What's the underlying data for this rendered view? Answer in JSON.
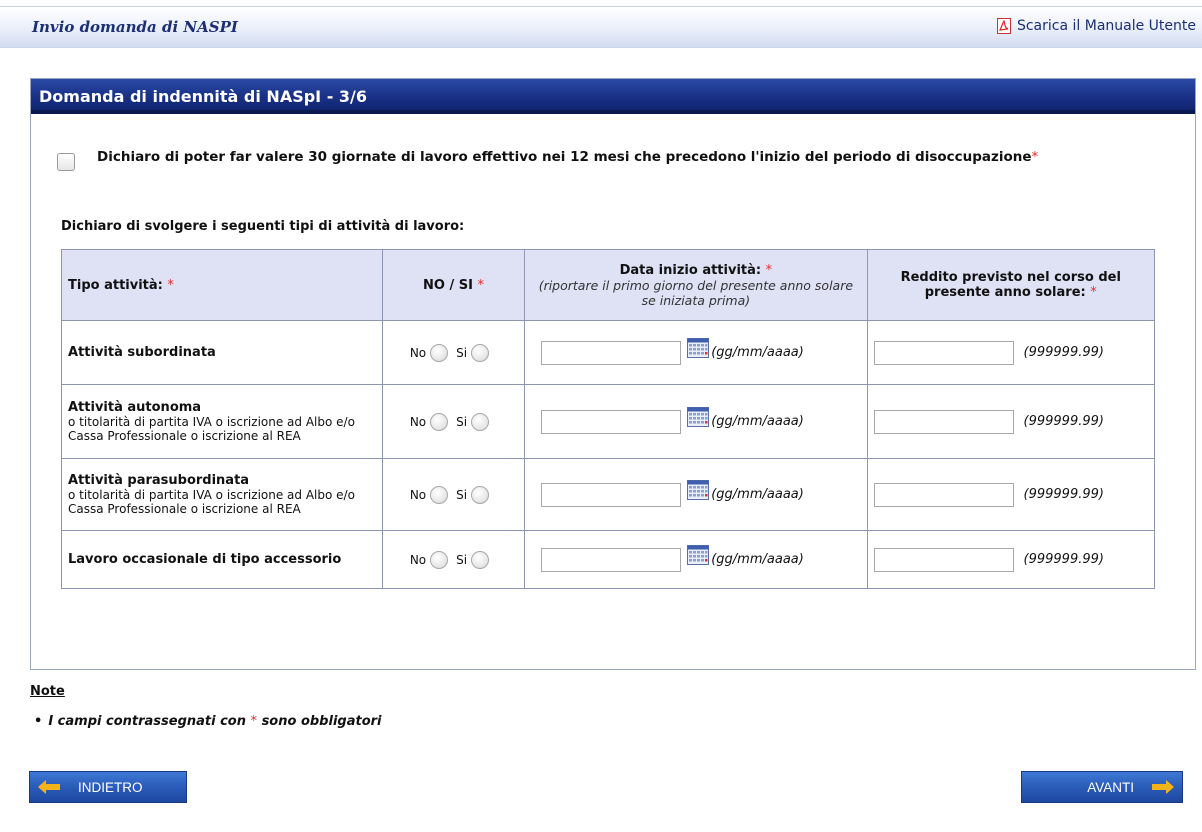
{
  "header": {
    "title": "Invio domanda di NASPI",
    "manual_link": "Scarica il Manuale Utente",
    "manual_icon": "pdf-icon"
  },
  "panel": {
    "title": "Domanda di indennità di NASpI - 3/6",
    "declaration": "Dichiaro di poter far valere 30 giornate di lavoro effettivo nei 12 mesi che precedono l'inizio del periodo di disoccupazione",
    "required_mark": "*",
    "activities_label": "Dichiaro di svolgere i seguenti tipi di attività di lavoro:",
    "table": {
      "headers": {
        "type": "Tipo attività:",
        "no_si": "NO / SI",
        "start_date": "Data inizio attività:",
        "start_date_note": "(riportare il primo giorno del presente anno solare se iniziata prima)",
        "income": "Reddito previsto nel corso del presente anno solare:"
      },
      "radio_no": "No",
      "radio_si": "Si",
      "date_hint": "(gg/mm/aaaa)",
      "income_hint": "(999999.99)",
      "rows": [
        {
          "title": "Attività subordinata",
          "desc": ""
        },
        {
          "title": "Attività autonoma",
          "desc": "o titolarità di partita IVA o iscrizione ad Albo e/o Cassa Professionale o iscrizione al REA"
        },
        {
          "title": "Attività parasubordinata",
          "desc": "o titolarità di partita IVA o iscrizione ad Albo e/o Cassa Professionale o iscrizione al REA"
        },
        {
          "title": "Lavoro occasionale di tipo accessorio",
          "desc": ""
        }
      ]
    }
  },
  "notes": {
    "title": "Note",
    "item_before": "I campi contrassegnati con",
    "item_mark": "*",
    "item_after": "sono obbligatori"
  },
  "buttons": {
    "back": "INDIETRO",
    "next": "AVANTI"
  },
  "colors": {
    "header_text": "#1c2e74",
    "panel_header": "#1a3288",
    "required": "#e32a2a",
    "table_header_bg": "#dfe1f5",
    "button_bg": "#2a5cb8",
    "arrow": "#f5b31a"
  }
}
